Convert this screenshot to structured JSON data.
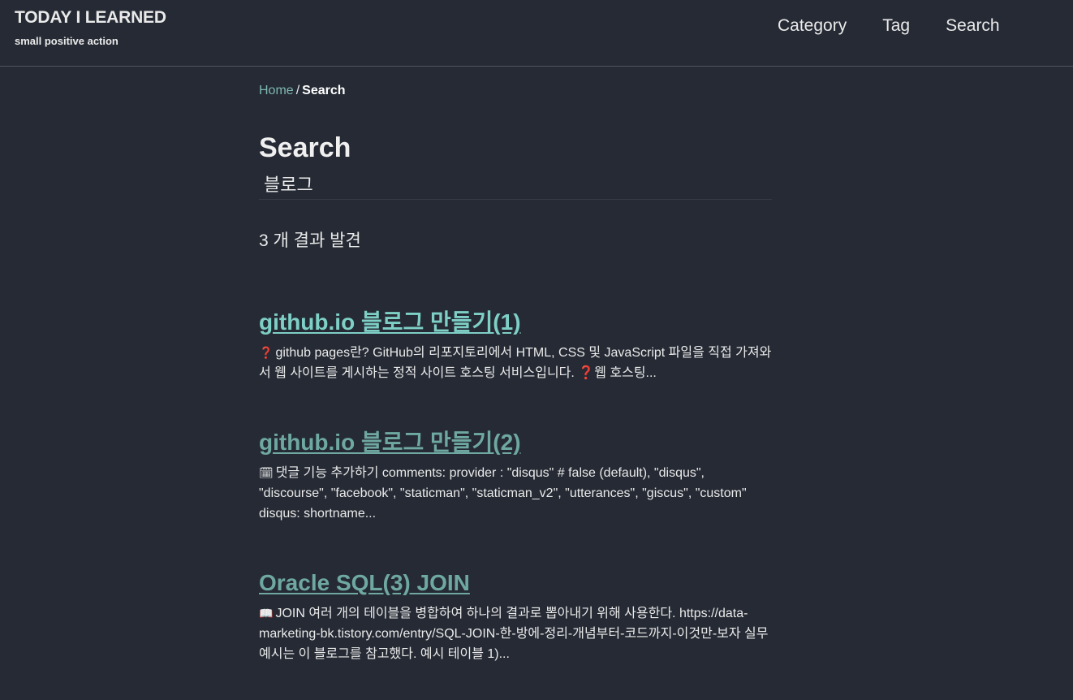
{
  "site": {
    "title": "TODAY I LEARNED",
    "subtitle": "small positive action"
  },
  "nav": {
    "items": [
      "Category",
      "Tag",
      "Search"
    ]
  },
  "breadcrumb": {
    "home": "Home",
    "separator": "/",
    "current": "Search"
  },
  "page": {
    "title": "Search",
    "search_value": "블로그",
    "results_count": "3 개 결과 발견"
  },
  "results": [
    {
      "title": "github.io 블로그 만들기(1)",
      "icon": "❓",
      "excerpt": "github pages란? GitHub의 리포지토리에서 HTML, CSS 및 JavaScript 파일을 직접 가져와서 웹 사이트를 게시하는 정적 사이트 호스팅 서비스입니다. ❓웹 호스팅...",
      "title_color": "#7ecfc6"
    },
    {
      "title": "github.io 블로그 만들기(2)",
      "icon": "🗓",
      "excerpt": "댓글 기능 추가하기 comments: provider : \"disqus\" # false (default), \"disqus\", \"discourse\", \"facebook\", \"staticman\", \"staticman_v2\", \"utterances\", \"giscus\", \"custom\" disqus: shortname...",
      "title_color": "#6fa8a1"
    },
    {
      "title": "Oracle SQL(3) JOIN",
      "icon": "📖",
      "excerpt": "JOIN 여러 개의 테이블을 병합하여 하나의 결과로 뽑아내기 위해 사용한다. https://data-marketing-bk.tistory.com/entry/SQL-JOIN-한-방에-정리-개념부터-코드까지-이것만-보자 실무 예시는 이 블로그를 참고했다. 예시 테이블 1)...",
      "title_color": "#6fa8a1"
    }
  ]
}
